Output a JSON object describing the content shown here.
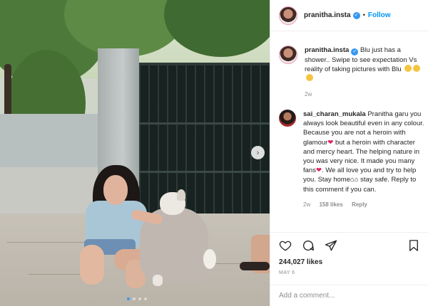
{
  "header": {
    "username": "pranitha.insta",
    "separator": "•",
    "follow_label": "Follow"
  },
  "caption": {
    "username": "pranitha.insta",
    "text": "Blu just has a shower.. Swipe to see expectation Vs reality of taking pictures with Blu",
    "time": "2w"
  },
  "comment": {
    "username": "sai_charan_mukala",
    "text_1": "Pranitha garu you always look beautiful even in any colour. Because you are not a heroin with glamour",
    "text_2": "but a heroin with character and mercy heart. The helping nature in you was very nice. It made you many fans",
    "text_3": ". We all love you and try to help you. Stay home",
    "text_4": "stay safe. Reply to this comment if you can.",
    "time": "2w",
    "likes": "158 likes",
    "reply_label": "Reply"
  },
  "actions": {
    "likes": "244,027 likes",
    "date": "MAY 6"
  },
  "add_comment": {
    "placeholder": "Add a comment..."
  },
  "carousel": {
    "next_icon": "›",
    "slides": 4,
    "active_slide": 1
  },
  "colors": {
    "accent": "#0095f6",
    "verified": "#3897f0",
    "muted": "#8e8e8e",
    "heart": "#e0245e"
  }
}
